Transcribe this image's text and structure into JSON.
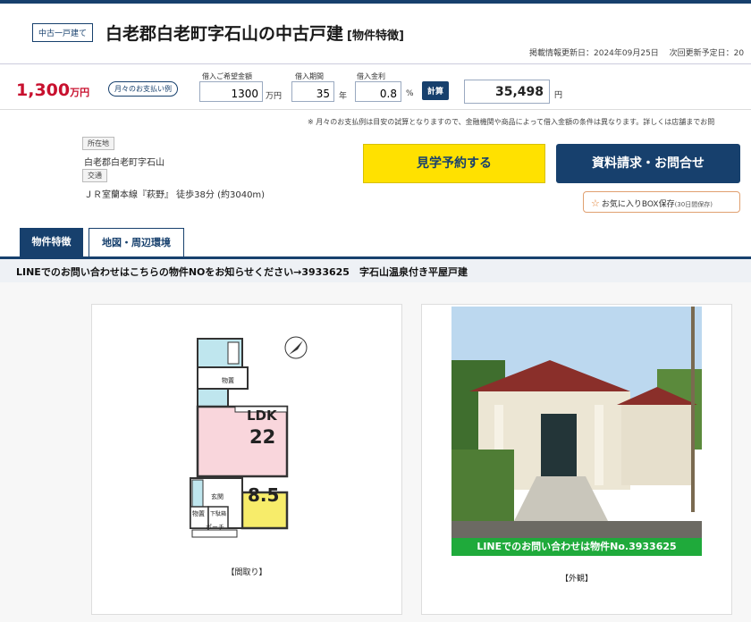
{
  "header": {
    "type_badge": "中古一戸建て",
    "title": "白老郡白老町字石山の中古戸建",
    "title_tag": "[物件特徴]",
    "dates": "掲載情報更新日：2024年09月25日　 次回更新予定日：20"
  },
  "pricebar": {
    "price": "1,300",
    "price_unit": "万円",
    "monthly_pill": "月々のお支払い例",
    "loan_amount_label": "借入ご希望金額",
    "loan_amount_value": "1300",
    "loan_amount_unit": "万円",
    "loan_term_label": "借入期間",
    "loan_term_value": "35",
    "loan_term_unit": "年",
    "interest_label": "借入金利",
    "interest_value": "0.8",
    "interest_unit": "%",
    "calc_button": "計算",
    "result_value": "35,498",
    "result_unit": "円"
  },
  "note": "※ 月々のお支払例は目安の試算となりますので、金融機関や商品によって借入金額の条件は異なります。詳しくは店舗までお問",
  "location": {
    "address_tag": "所在地",
    "address": "白老郡白老町字石山",
    "transport_tag": "交通",
    "transport": "ＪＲ室蘭本線『萩野』 徒歩38分 (約3040m)"
  },
  "actions": {
    "visit_button": "見学予約する",
    "request_button": "資料請求・お問合せ",
    "favorite_button": "お気に入りBOX保存",
    "favorite_note": "(30日間保存)"
  },
  "tabs": [
    {
      "label": "物件特徴"
    },
    {
      "label": "地図・周辺環境"
    }
  ],
  "line_notice": "LINEでのお問い合わせはこちらの物件NOをお知らせください→3933625　字石山温泉付き平屋戸建",
  "gallery": {
    "floorplan_caption": "【間取り】",
    "floorplan_labels": {
      "ldk": "LDK",
      "ldk_size": "22",
      "room_size": "8.5",
      "storage1": "物置",
      "storage2": "物置",
      "entrance": "玄関",
      "shoe": "下駄箱",
      "porch": "ポーチ"
    },
    "exterior_caption": "【外観】",
    "exterior_banner": "LINEでのお問い合わせは物件No.3933625"
  },
  "colors": {
    "navy": "#17406d",
    "price_red": "#c8102e",
    "visit_yellow": "#ffe100",
    "line_green": "#1faa3b"
  }
}
